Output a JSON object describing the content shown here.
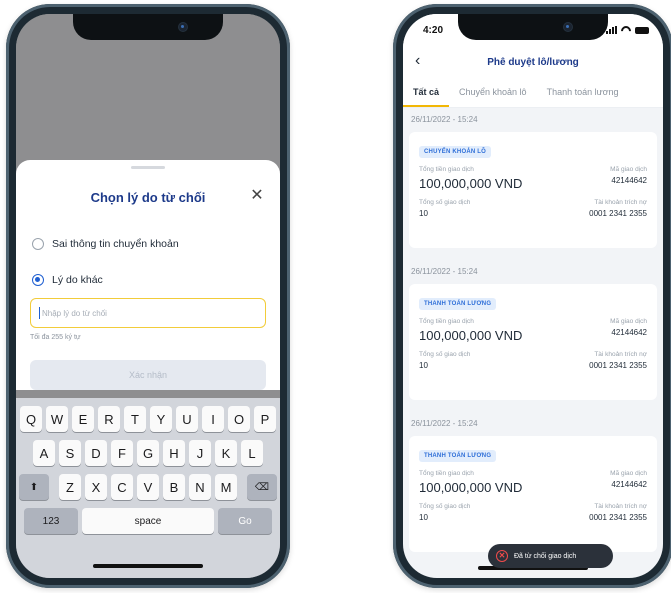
{
  "left_phone": {
    "sheet": {
      "title": "Chọn lý do từ chối",
      "close_glyph": "✕",
      "options": [
        {
          "label": "Sai thông tin chuyển khoản",
          "selected": false
        },
        {
          "label": "Lý do khác",
          "selected": true
        }
      ],
      "input_placeholder": "Nhập lý do từ chối",
      "hint": "Tối đa 255 ký tự",
      "confirm_label": "Xác nhận"
    },
    "keyboard": {
      "row1": [
        "Q",
        "W",
        "E",
        "R",
        "T",
        "Y",
        "U",
        "I",
        "O",
        "P"
      ],
      "row2": [
        "A",
        "S",
        "D",
        "F",
        "G",
        "H",
        "J",
        "K",
        "L"
      ],
      "row3": [
        "Z",
        "X",
        "C",
        "V",
        "B",
        "N",
        "M"
      ],
      "shift_glyph": "⬆",
      "delete_glyph": "⌫",
      "num_label": "123",
      "space_label": "space",
      "go_label": "Go"
    }
  },
  "right_phone": {
    "status": {
      "time": "4:20"
    },
    "nav": {
      "back_glyph": "‹",
      "title": "Phê duyệt lô/lương"
    },
    "tabs": [
      {
        "label": "Tất cả",
        "active": true
      },
      {
        "label": "Chuyển khoản lô",
        "active": false
      },
      {
        "label": "Thanh toán lương",
        "active": false
      }
    ],
    "groups": [
      {
        "date": "26/11/2022 - 15:24",
        "badge": "CHUYỂN KHOẢN LÔ",
        "amount_label": "Tổng tiền giao dịch",
        "amount": "100,000,000 VND",
        "code_label": "Mã giao dịch",
        "code": "42144642",
        "count_label": "Tổng số giao dịch",
        "count": "10",
        "account_label": "Tài khoản trích nợ",
        "account": "0001 2341 2355"
      },
      {
        "date": "26/11/2022 - 15:24",
        "badge": "THANH TOÁN LƯƠNG",
        "amount_label": "Tổng tiền giao dịch",
        "amount": "100,000,000 VND",
        "code_label": "Mã giao dịch",
        "code": "42144642",
        "count_label": "Tổng số giao dịch",
        "count": "10",
        "account_label": "Tài khoản trích nợ",
        "account": "0001 2341 2355"
      },
      {
        "date": "26/11/2022 - 15:24",
        "badge": "THANH TOÁN LƯƠNG",
        "amount_label": "Tổng tiền giao dịch",
        "amount": "100,000,000 VND",
        "code_label": "Mã giao dịch",
        "code": "42144642",
        "count_label": "Tổng số giao dịch",
        "count": "10",
        "account_label": "Tài khoản trích nợ",
        "account": "0001 2341 2355"
      }
    ],
    "toast": {
      "icon_glyph": "✕",
      "text": "Đã từ chối giao dịch"
    }
  },
  "colors": {
    "frame": "#1d2a33",
    "primary_text": "#1d3a8a",
    "accent_yellow": "#f2b705",
    "badge_blue": "#2f6fd8",
    "error_red": "#f04b4b"
  }
}
